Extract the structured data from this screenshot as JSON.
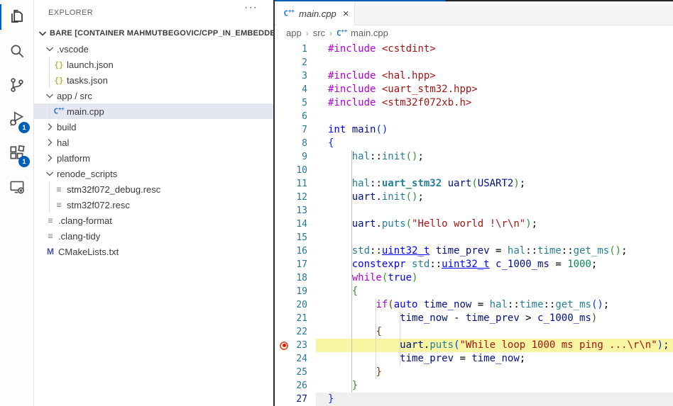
{
  "explorer": {
    "title": "EXPLORER",
    "more_actions": "···",
    "root": "BARE [CONTAINER MAHMUTBEGOVIC/CPP_IN_EMBEDDED...",
    "items": [
      {
        "label": ".vscode",
        "level": 1,
        "kind": "folder",
        "expanded": true
      },
      {
        "label": "launch.json",
        "level": 2,
        "kind": "file",
        "icon": "json"
      },
      {
        "label": "tasks.json",
        "level": 2,
        "kind": "file",
        "icon": "json"
      },
      {
        "label": "app / src",
        "level": 1,
        "kind": "folder",
        "expanded": true
      },
      {
        "label": "main.cpp",
        "level": 2,
        "kind": "file",
        "icon": "cpp",
        "selected": true
      },
      {
        "label": "build",
        "level": 1,
        "kind": "folder",
        "expanded": false
      },
      {
        "label": "hal",
        "level": 1,
        "kind": "folder",
        "expanded": false
      },
      {
        "label": "platform",
        "level": 1,
        "kind": "folder",
        "expanded": false
      },
      {
        "label": "renode_scripts",
        "level": 1,
        "kind": "folder",
        "expanded": true
      },
      {
        "label": "stm32f072_debug.resc",
        "level": 2,
        "kind": "file",
        "icon": "txt"
      },
      {
        "label": "stm32f072.resc",
        "level": 2,
        "kind": "file",
        "icon": "txt"
      },
      {
        "label": ".clang-format",
        "level": 1,
        "kind": "file",
        "icon": "txt"
      },
      {
        "label": ".clang-tidy",
        "level": 1,
        "kind": "file",
        "icon": "txt"
      },
      {
        "label": "CMakeLists.txt",
        "level": 1,
        "kind": "file",
        "icon": "cmake"
      }
    ]
  },
  "activity_bar": {
    "badges": {
      "debug": "1",
      "extensions": "1"
    }
  },
  "tab": {
    "title": "main.cpp",
    "close": "×"
  },
  "breadcrumb": {
    "0": "app",
    "1": "src",
    "2": "main.cpp",
    "sep": "›"
  },
  "editor": {
    "breakpoint_line": 23,
    "debug_line": 23,
    "active_line": 27,
    "lines": [
      [
        [
          "pre",
          "#include"
        ],
        [
          "pl",
          " "
        ],
        [
          "str",
          "<cstdint>"
        ]
      ],
      [],
      [
        [
          "pre",
          "#include"
        ],
        [
          "pl",
          " "
        ],
        [
          "str",
          "<hal.hpp>"
        ]
      ],
      [
        [
          "pre",
          "#include"
        ],
        [
          "pl",
          " "
        ],
        [
          "str",
          "<uart_stm32.hpp>"
        ]
      ],
      [
        [
          "pre",
          "#include"
        ],
        [
          "pl",
          " "
        ],
        [
          "str",
          "<stm32f072xb.h>"
        ]
      ],
      [],
      [
        [
          "kw",
          "int"
        ],
        [
          "pl",
          " "
        ],
        [
          "fn",
          "main"
        ],
        [
          "b1",
          "()"
        ]
      ],
      [
        [
          "b1",
          "{"
        ]
      ],
      [
        [
          "pl",
          "    "
        ],
        [
          "type",
          "hal"
        ],
        [
          "pl",
          "::"
        ],
        [
          "type",
          "init"
        ],
        [
          "b2",
          "()"
        ],
        [
          "pl",
          ";"
        ]
      ],
      [],
      [
        [
          "pl",
          "    "
        ],
        [
          "type",
          "hal"
        ],
        [
          "pl",
          "::"
        ],
        [
          "typeb",
          "uart_stm32"
        ],
        [
          "pl",
          " "
        ],
        [
          "var",
          "uart"
        ],
        [
          "b2",
          "("
        ],
        [
          "var",
          "USART2"
        ],
        [
          "b2",
          ")"
        ],
        [
          "pl",
          ";"
        ]
      ],
      [
        [
          "pl",
          "    "
        ],
        [
          "var",
          "uart"
        ],
        [
          "pl",
          "."
        ],
        [
          "type",
          "init"
        ],
        [
          "b2",
          "()"
        ],
        [
          "pl",
          ";"
        ]
      ],
      [],
      [
        [
          "pl",
          "    "
        ],
        [
          "var",
          "uart"
        ],
        [
          "pl",
          "."
        ],
        [
          "type",
          "puts"
        ],
        [
          "b2",
          "("
        ],
        [
          "str",
          "\"Hello world !\\r\\n\""
        ],
        [
          "b2",
          ")"
        ],
        [
          "pl",
          ";"
        ]
      ],
      [],
      [
        [
          "pl",
          "    "
        ],
        [
          "type",
          "std"
        ],
        [
          "pl",
          "::"
        ],
        [
          "u",
          "uint32_t"
        ],
        [
          "pl",
          " "
        ],
        [
          "var",
          "time_prev"
        ],
        [
          "pl",
          " = "
        ],
        [
          "type",
          "hal"
        ],
        [
          "pl",
          "::"
        ],
        [
          "type",
          "time"
        ],
        [
          "pl",
          "::"
        ],
        [
          "type",
          "get_ms"
        ],
        [
          "b2",
          "()"
        ],
        [
          "pl",
          ";"
        ]
      ],
      [
        [
          "pl",
          "    "
        ],
        [
          "kw",
          "constexpr"
        ],
        [
          "pl",
          " "
        ],
        [
          "type",
          "std"
        ],
        [
          "pl",
          "::"
        ],
        [
          "u",
          "uint32_t"
        ],
        [
          "pl",
          " "
        ],
        [
          "var",
          "c_1000_ms"
        ],
        [
          "pl",
          " = "
        ],
        [
          "num",
          "1000"
        ],
        [
          "pl",
          ";"
        ]
      ],
      [
        [
          "pl",
          "    "
        ],
        [
          "ctl",
          "while"
        ],
        [
          "b2",
          "("
        ],
        [
          "kw",
          "true"
        ],
        [
          "b2",
          ")"
        ]
      ],
      [
        [
          "pl",
          "    "
        ],
        [
          "b2",
          "{"
        ]
      ],
      [
        [
          "pl",
          "        "
        ],
        [
          "ctl",
          "if"
        ],
        [
          "b3",
          "("
        ],
        [
          "kw",
          "auto"
        ],
        [
          "pl",
          " "
        ],
        [
          "var",
          "time_now"
        ],
        [
          "pl",
          " = "
        ],
        [
          "type",
          "hal"
        ],
        [
          "pl",
          "::"
        ],
        [
          "type",
          "time"
        ],
        [
          "pl",
          "::"
        ],
        [
          "type",
          "get_ms"
        ],
        [
          "b1",
          "()"
        ],
        [
          "pl",
          ";"
        ]
      ],
      [
        [
          "pl",
          "            "
        ],
        [
          "var",
          "time_now"
        ],
        [
          "pl",
          " - "
        ],
        [
          "var",
          "time_prev"
        ],
        [
          "pl",
          " > "
        ],
        [
          "var",
          "c_1000_ms"
        ],
        [
          "b3",
          ")"
        ]
      ],
      [
        [
          "pl",
          "        "
        ],
        [
          "b3",
          "{"
        ]
      ],
      [
        [
          "pl",
          "            "
        ],
        [
          "var",
          "uart"
        ],
        [
          "pl",
          "."
        ],
        [
          "type",
          "puts"
        ],
        [
          "b1",
          "("
        ],
        [
          "str",
          "\"While loop 1000 ms ping ...\\r\\n\""
        ],
        [
          "b1",
          ")"
        ],
        [
          "pl",
          ";"
        ]
      ],
      [
        [
          "pl",
          "            "
        ],
        [
          "var",
          "time_prev"
        ],
        [
          "pl",
          " = "
        ],
        [
          "var",
          "time_now"
        ],
        [
          "pl",
          ";"
        ]
      ],
      [
        [
          "pl",
          "        "
        ],
        [
          "b3",
          "}"
        ]
      ],
      [
        [
          "pl",
          "    "
        ],
        [
          "b2",
          "}"
        ]
      ],
      [
        [
          "b1",
          "}"
        ]
      ]
    ]
  },
  "colors": {
    "accent": "#005FB8",
    "badge": "#005FB8",
    "tab_active_border_top": "#005FB8",
    "list_selection": "#e4e6f1",
    "debug_line_highlight": "#f8f5a3",
    "current_line_highlight": "#efefef",
    "breakpoint": "#e51400",
    "keyword": "#0000ff",
    "control_keyword": "#af00db",
    "string": "#a31515",
    "type": "#267f99",
    "variable": "#001080",
    "number": "#098658"
  }
}
